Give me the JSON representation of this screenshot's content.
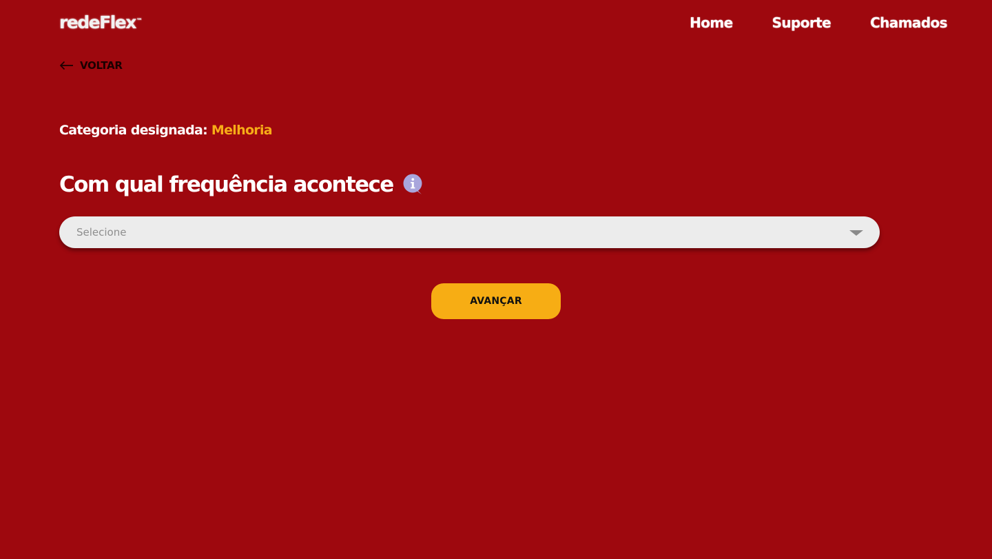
{
  "header": {
    "logo_text": "redeFlex",
    "logo_mark": "™",
    "nav": [
      {
        "label": "Home"
      },
      {
        "label": "Suporte"
      },
      {
        "label": "Chamados"
      }
    ]
  },
  "back": {
    "icon": "arrow-left-icon",
    "label": "VOLTAR"
  },
  "category": {
    "label": "Categoria designada:",
    "value": "Melhoria"
  },
  "question": {
    "title": "Com qual frequência acontece",
    "info_icon": "info-chat-bubble-icon"
  },
  "frequency_select": {
    "placeholder": "Selecione",
    "icon": "caret-down-icon"
  },
  "actions": {
    "next_label": "AVANÇAR"
  },
  "colors": {
    "background": "#9e080e",
    "accent": "#f7ad14",
    "highlight_text": "#f7ac17",
    "select_bg": "#ececec",
    "info_icon": "#a9a6dc"
  }
}
